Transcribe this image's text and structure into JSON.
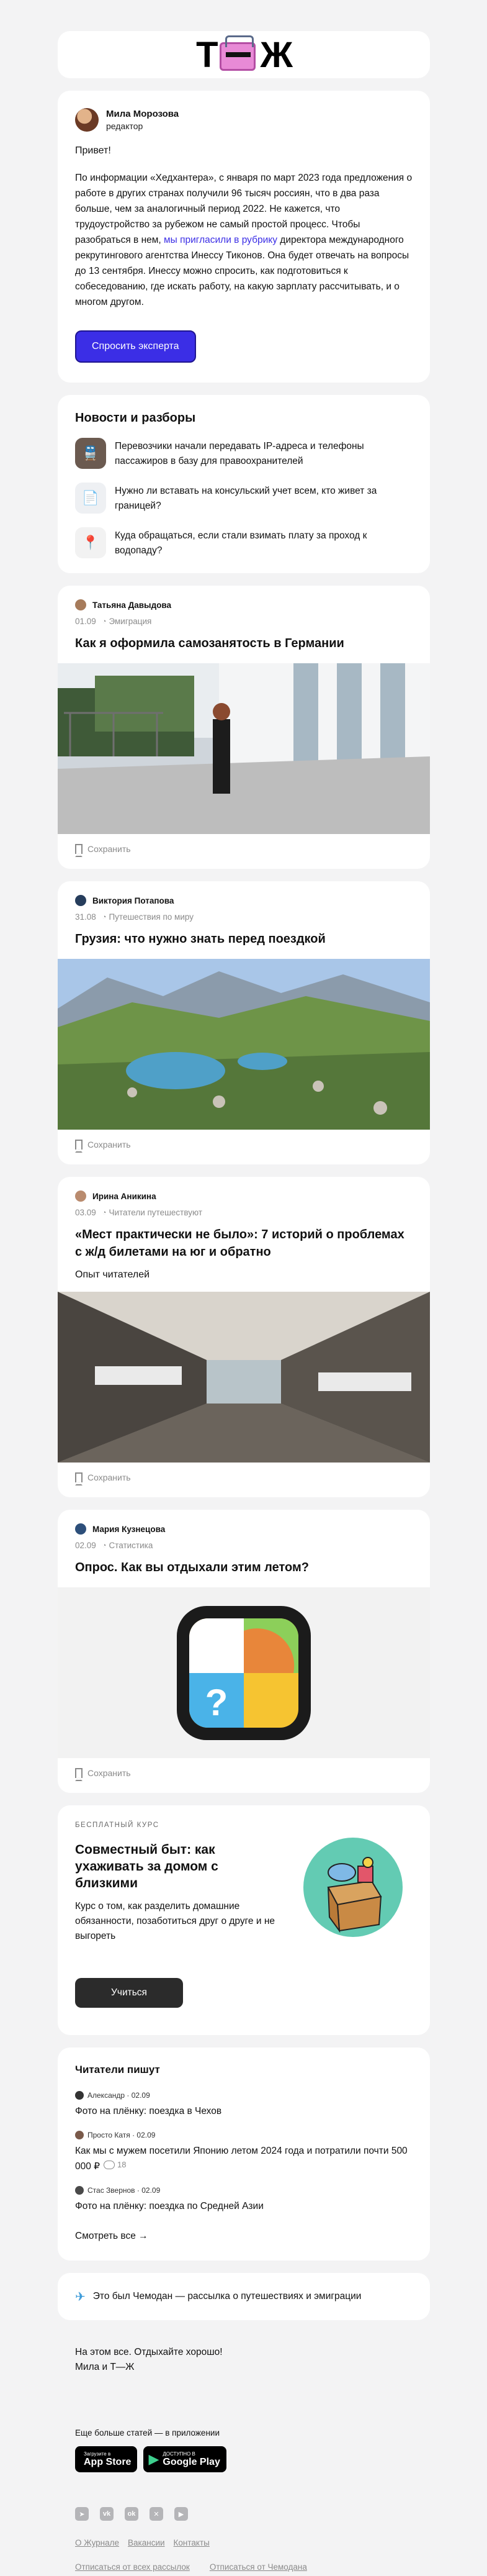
{
  "header": {
    "logo_left": "Т",
    "logo_right": "Ж"
  },
  "intro": {
    "author_name": "Мила Морозова",
    "author_role": "редактор",
    "greeting": "Привет!",
    "text_before_link": "По информации «Хедхантера», с января по март 2023 года предложения о работе в других странах получили 96 тысяч россиян, что в два раза больше, чем за аналогичный период 2022. Не кажется, что трудоустройство за рубежом не самый простой процесс. Чтобы разобраться в нем, ",
    "link_text": "мы пригласили в рубрику",
    "text_after_link": " директора международного рекрутингового агентства Инессу Тиконов. Она будет отвечать на вопросы до 13 сентября. Инессу можно спросить, как подготовиться к собеседованию, где искать работу, на какую зарплату рассчитывать, и о многом другом.",
    "button": "Спросить эксперта"
  },
  "news": {
    "title": "Новости и разборы",
    "items": [
      {
        "text": "Перевозчики начали передавать IP-адреса и телефоны пассажиров в базу для правоохранителей",
        "icon": "train-icon",
        "bg": "#6b5a50",
        "glyph": "🚆"
      },
      {
        "text": "Нужно ли вставать на консульский учет всем, кто живет за границей?",
        "icon": "document-icon",
        "bg": "#eef0f3",
        "glyph": "📄"
      },
      {
        "text": "Куда обращаться, если стали взимать плату за проход к водопаду?",
        "icon": "pin-icon",
        "bg": "#f2f2f2",
        "glyph": "📍"
      }
    ]
  },
  "articles": [
    {
      "author": "Татьяна Давыдова",
      "date": "01.09",
      "tag": "Эмиграция",
      "title": "Как я оформила самозанятость в Германии",
      "subtitle": "",
      "save": "Сохранить",
      "image": "germany"
    },
    {
      "author": "Виктория Потапова",
      "date": "31.08",
      "tag": "Путешествия по миру",
      "title": "Грузия: что нужно знать перед поездкой",
      "subtitle": "",
      "save": "Сохранить",
      "image": "georgia"
    },
    {
      "author": "Ирина Аникина",
      "date": "03.09",
      "tag": "Читатели путешествуют",
      "title": "«Мест практически не было»: 7 историй о проблемах с ж/д билетами на юг и обратно",
      "subtitle": "Опыт читателей",
      "save": "Сохранить",
      "image": "train"
    },
    {
      "author": "Мария Кузнецова",
      "date": "02.09",
      "tag": "Статистика",
      "title": "Опрос. Как вы отдыхали этим летом?",
      "subtitle": "",
      "save": "Сохранить",
      "image": "poll"
    }
  ],
  "course": {
    "label": "БЕСПЛАТНЫЙ КУРС",
    "title": "Совместный быт: как ухаживать за домом с близкими",
    "text": "Курс о том, как разделить домашние обязанности, позаботиться друг о друге и не выгореть",
    "button": "Учиться"
  },
  "readers": {
    "title": "Читатели пишут",
    "items": [
      {
        "name": "Александр",
        "date": "02.09",
        "text": "Фото на плёнку: поездка в Чехов",
        "comments": ""
      },
      {
        "name": "Просто Катя",
        "date": "02.09",
        "text": "Как мы с мужем посетили Японию летом 2024 года и потратили почти 500 000 ₽",
        "comments": "18"
      },
      {
        "name": "Стас Звернов",
        "date": "02.09",
        "text": "Фото на плёнку: поездка по Средней Азии",
        "comments": ""
      }
    ],
    "more": "Смотреть все  →"
  },
  "chemodan": {
    "text": "Это был Чемодан — рассылка о путешествиях и эмиграции"
  },
  "outro": {
    "line1": "На этом все. Отдыхайте хорошо!",
    "line2": "Мила и Т—Ж"
  },
  "apps": {
    "title": "Еще больше статей — в приложении",
    "appstore_small": "Загрузите в",
    "appstore_big": "App Store",
    "gplay_small": "ДОСТУПНО В",
    "gplay_big": "Google Play"
  },
  "socials": [
    "telegram-icon",
    "vk-icon",
    "odnoklassniki-icon",
    "x-icon",
    "youtube-icon"
  ],
  "links": [
    "О Журнале",
    "Вакансии",
    "Контакты"
  ],
  "unsubscribe": [
    "Отписаться от всех рассылок",
    "Отписаться от Чемодана"
  ]
}
